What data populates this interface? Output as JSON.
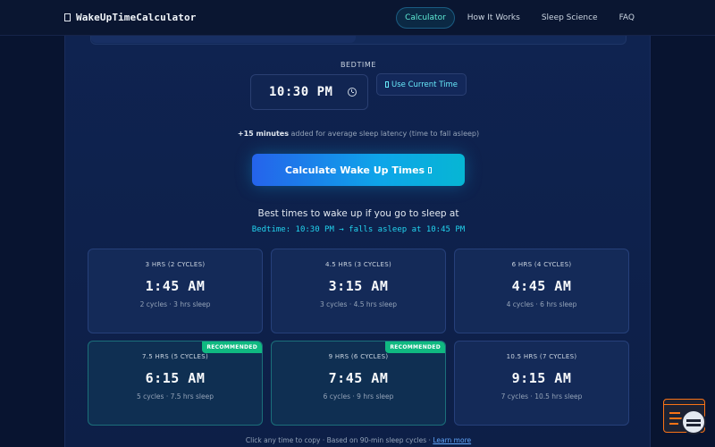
{
  "header": {
    "logo_icon": "boxed-glyph",
    "logo_text": "WakeUpTimeCalculator",
    "nav": [
      {
        "label": "Calculator",
        "active": true
      },
      {
        "label": "How It Works",
        "active": false
      },
      {
        "label": "Sleep Science",
        "active": false
      },
      {
        "label": "FAQ",
        "active": false
      }
    ]
  },
  "form": {
    "bedtime_label": "BEDTIME",
    "bedtime_value": "10:30 PM",
    "use_current_label": "Use Current Time",
    "use_current_icon": "boxed-glyph",
    "latency_bold": "+15 minutes",
    "latency_rest": " added for average sleep latency (time to fall asleep)",
    "calculate_label": "Calculate Wake Up Times",
    "calculate_icon": "boxed-glyph"
  },
  "results": {
    "title": "Best times to wake up if you go to sleep at",
    "subtitle": "Bedtime: 10:30 PM → falls asleep at 10:45 PM",
    "cards": [
      {
        "label": "3 HRS (2 CYCLES)",
        "time": "1:45 AM",
        "detail": "2 cycles · 3 hrs sleep",
        "badge": ""
      },
      {
        "label": "4.5 HRS (3 CYCLES)",
        "time": "3:15 AM",
        "detail": "3 cycles · 4.5 hrs sleep",
        "badge": ""
      },
      {
        "label": "6 HRS (4 CYCLES)",
        "time": "4:45 AM",
        "detail": "4 cycles · 6 hrs sleep",
        "badge": ""
      },
      {
        "label": "7.5 HRS (5 CYCLES)",
        "time": "6:15 AM",
        "detail": "5 cycles · 7.5 hrs sleep",
        "badge": "RECOMMENDED"
      },
      {
        "label": "9 HRS (6 CYCLES)",
        "time": "7:45 AM",
        "detail": "6 cycles · 9 hrs sleep",
        "badge": "RECOMMENDED"
      },
      {
        "label": "10.5 HRS (7 CYCLES)",
        "time": "9:15 AM",
        "detail": "7 cycles · 10.5 hrs sleep",
        "badge": ""
      }
    ],
    "footer_text": "Click any time to copy · Based on 90-min sleep cycles · ",
    "footer_link": "Learn more"
  },
  "colors": {
    "accent_cyan": "#22d3ee",
    "recommended_green": "#10b981",
    "primary_blue": "#2563eb",
    "widget_orange": "#f97316"
  }
}
